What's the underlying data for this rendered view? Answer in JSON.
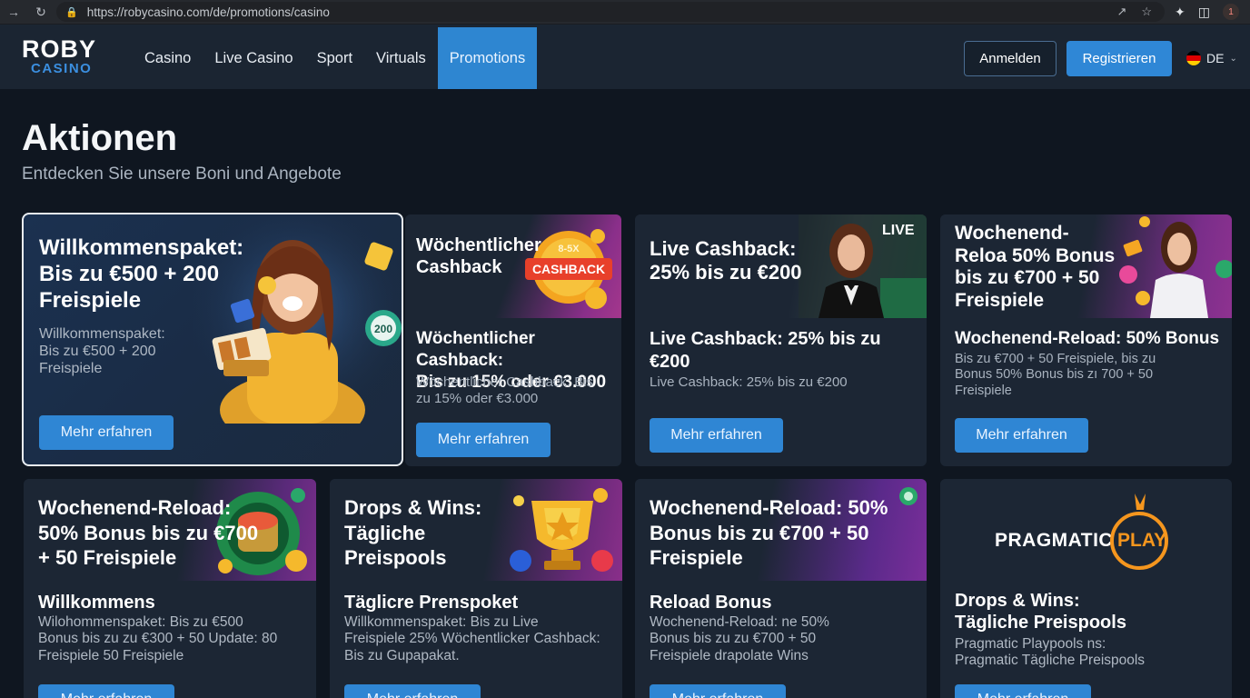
{
  "browser": {
    "url": "https://robycasino.com/de/promotions/casino"
  },
  "header": {
    "logo_top": "ROBY",
    "logo_bottom": "CASINO",
    "nav": [
      "Casino",
      "Live Casino",
      "Sport",
      "Virtuals",
      "Promotions"
    ],
    "active_nav": "Promotions",
    "login_label": "Anmelden",
    "register_label": "Registrieren",
    "language": "DE"
  },
  "page": {
    "title": "Aktionen",
    "subtitle": "Entdecken Sie unsere Boni und Angebote"
  },
  "cards": [
    {
      "banner_title": "Willkommenspaket:\nBis zu €500 + 200\nFreispiele",
      "desc": "Willkommenspaket:\nBis zu €500 + 200\nFreispiele",
      "button": "Mehr erfahren"
    },
    {
      "banner_title": "Wöchentlicher\nCashback",
      "badge_top": "8-5X",
      "badge": "CASHBACK",
      "heading": "Wöchentlicher Cashback:\nBis zu 15% oder €3.000",
      "desc": "Wöchentlicher Cashback: Bis\nzu 15% oder €3.000",
      "button": "Mehr erfahren"
    },
    {
      "banner_title": "Live Cashback:\n25% bis zu €200",
      "live_tag": "LIVE",
      "heading": "Live Cashback: 25% bis zu\n€200",
      "desc": "Live Cashback: 25% bis zu €200",
      "button": "Mehr erfahren"
    },
    {
      "banner_title": "Wochenend-\nReloa 50% Bonus\nbis zu €700 + 50\nFreispiele",
      "heading": "Wochenend-Reload: 50% Bonus",
      "desc": "Bis zu €700 + 50 Freispiele, bis zu\nBonus 50% Bonus bis zı 700 + 50\nFreispiele",
      "button": "Mehr erfahren"
    },
    {
      "banner_title": "Wochenend-Reload:\n50% Bonus bis zu €700\n+ 50 Freispiele",
      "heading": "Willkommens",
      "desc": "Wilohommenspaket:  Bis zu €500\nBonus bis zu zu €300 + 50 Update: 80\nFreispiele 50 Freispiele",
      "button": "Mehr erfahren"
    },
    {
      "banner_title": "Drops & Wins:\nTägliche\nPreispools",
      "heading": "Täglicre Prenspoket",
      "desc": "Willkommenspaket: Bis zu Live\nFreispiele 25% Wöchentlicker Cashback:\nBis zu Gupapakat.",
      "button": "Mehr erfahren"
    },
    {
      "banner_title": "Wochenend-Reload: 50%\nBonus bis zu €700 + 50\nFreispiele",
      "heading": "Reload Bonus",
      "desc": "Wochenend-Reload: ne 50%\nBonus bis zu zu €700 + 50\nFreispiele drapolate Wins",
      "button": "Mehr erfahren"
    },
    {
      "logo_left": "PRAGMATIC",
      "logo_right": "PLAY",
      "heading": "Drops & Wins:\nTägliche Preispools",
      "desc": "Pragmatic Playpools ns:\nPragmatic Tägliche Preispools",
      "button": "Mehr erfahren"
    }
  ],
  "colors": {
    "accent": "#2f87d6",
    "background": "#0f1620",
    "header": "#1b2532",
    "card": "#1c2634"
  }
}
